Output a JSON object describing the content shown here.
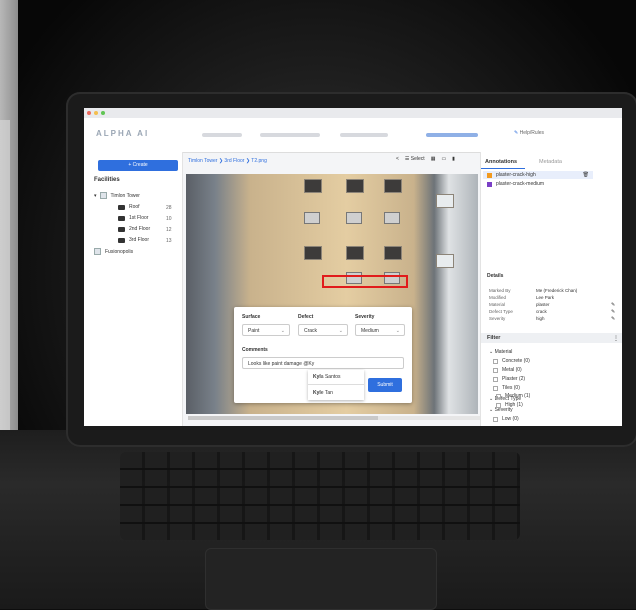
{
  "app": {
    "logo": "ALPHA AI",
    "help": "Help/Rules"
  },
  "sidebar": {
    "create_label": "+ Create",
    "facilities_title": "Facilities",
    "tree": [
      {
        "label": "Timlon Tower",
        "count": ""
      },
      {
        "label": "Roof",
        "count": "28"
      },
      {
        "label": "1st Floor",
        "count": "10"
      },
      {
        "label": "2nd Floor",
        "count": "12"
      },
      {
        "label": "3rd Floor",
        "count": "13"
      },
      {
        "label": "Fusionopolis",
        "count": ""
      }
    ]
  },
  "main": {
    "breadcrumb": "Timlon Tower ❯ 3rd Floor ❯ T2.png",
    "select_label": "Select"
  },
  "popup": {
    "surface_label": "Surface",
    "defect_label": "Defect",
    "severity_label": "Severity",
    "surface_value": "Paint",
    "defect_value": "Crack",
    "severity_value": "Medium",
    "comments_label": "Comments",
    "comment_value": "Looks like paint damage @Ky",
    "mention_1_bold": "Kyl",
    "mention_1_rest": "a Santos",
    "mention_2_bold": "Kyl",
    "mention_2_rest": "e Tan",
    "submit_label": "Submit"
  },
  "rpanel": {
    "tab_annotations": "Annotations",
    "tab_metadata": "Metadata",
    "annotations": [
      {
        "label": "plaster-crack-high",
        "color": "#f29a1f"
      },
      {
        "label": "plaster-crack-medium",
        "color": "#7a3fc6"
      }
    ],
    "details_title": "Details",
    "details": [
      {
        "k": "Marked By",
        "v": "Me (Frederick Chan)"
      },
      {
        "k": "Modified",
        "v": "Lee Park"
      },
      {
        "k": "Material",
        "v": "plaster"
      },
      {
        "k": "Defect Type",
        "v": "crack"
      },
      {
        "k": "Severity",
        "v": "high"
      }
    ],
    "filter_title": "Filter",
    "material_title": "Material",
    "materials": [
      "Concrete (0)",
      "Metal (0)",
      "Plaster (2)",
      "Tiles (0)"
    ],
    "defect_type_title": "Defect Type",
    "severity_title": "Severity",
    "severities": [
      "Low (0)",
      "Medium (1)",
      "High (1)"
    ]
  }
}
